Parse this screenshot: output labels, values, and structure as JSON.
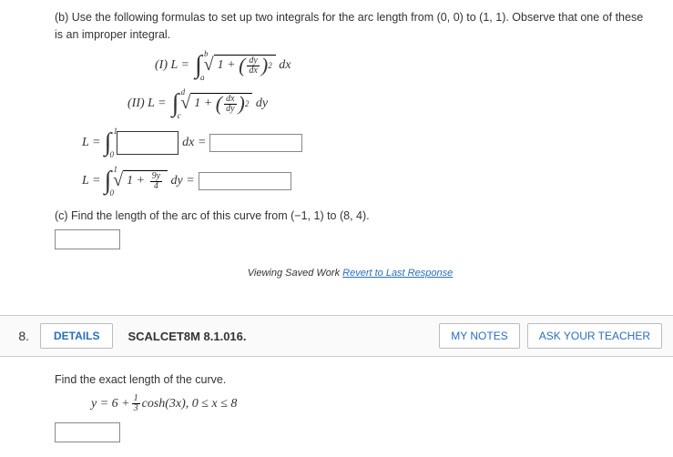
{
  "partB": {
    "text": "(b) Use the following formulas to set up two integrals for the arc length from (0, 0) to (1, 1). Observe that one of these is an improper integral.",
    "formula1_label": "(I)  L =",
    "formula2_label": "(II)  L =",
    "ub1": "b",
    "lb1": "a",
    "ub2": "d",
    "lb2": "c",
    "dx": "dx",
    "dy": "dy",
    "one": "1",
    "plus": "+",
    "dydx_num": "dy",
    "dydx_den": "dx",
    "dxdy_num": "dx",
    "dxdy_den": "dy",
    "sq": "2"
  },
  "inputs": {
    "L_eq": "L =",
    "int_lb": "0",
    "int_ub": "1",
    "dx_eq": "dx =",
    "dy_eq": "dy =",
    "one": "1",
    "plus": "+",
    "frac_num": "9y",
    "frac_den": "4"
  },
  "partC": {
    "text": "(c) Find the length of the arc of this curve from  (−1, 1) to (8, 4)."
  },
  "viewing": {
    "pre": "Viewing Saved Work ",
    "link": "Revert to Last Response"
  },
  "q8": {
    "num": "8.",
    "details": "DETAILS",
    "ref": "SCALCET8M 8.1.016.",
    "notes": "MY NOTES",
    "ask": "ASK YOUR TEACHER",
    "prompt": "Find the exact length of the curve.",
    "eq_pre": "y = 6 + ",
    "frac_num": "1",
    "frac_den": "3",
    "eq_post": " cosh(3x),   0 ≤ x ≤ 8"
  }
}
